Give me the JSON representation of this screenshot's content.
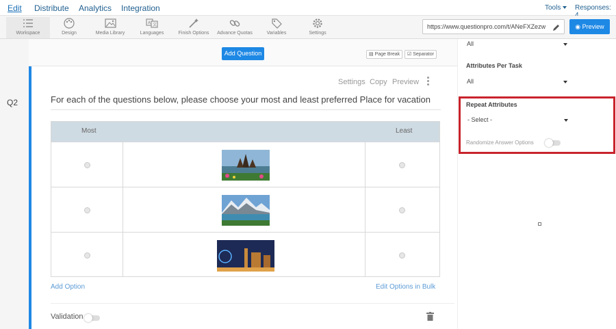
{
  "topnav": {
    "items": [
      "Edit",
      "Distribute",
      "Analytics",
      "Integration"
    ],
    "tools_label": "Tools",
    "responses_label": "Responses: 4"
  },
  "toolbar": {
    "items": [
      {
        "label": "Workspace",
        "icon": "list-icon"
      },
      {
        "label": "Design",
        "icon": "palette-icon"
      },
      {
        "label": "Media Library",
        "icon": "image-icon"
      },
      {
        "label": "Languages",
        "icon": "translate-icon"
      },
      {
        "label": "Finish Options",
        "icon": "magic-wand-icon"
      },
      {
        "label": "Advance Quotas",
        "icon": "link-icon"
      },
      {
        "label": "Variables",
        "icon": "tag-icon"
      },
      {
        "label": "Settings",
        "icon": "gear-icon"
      }
    ],
    "url": "https://www.questionpro.com/t/ANeFXZezw",
    "preview_label": "Preview"
  },
  "canvas": {
    "add_question_label": "Add Question",
    "page_break_label": "Page Break",
    "separator_label": "Separator"
  },
  "question": {
    "number": "Q2",
    "tools": [
      "Settings",
      "Copy",
      "Preview"
    ],
    "text": "For each of the questions below, please choose your most and least preferred Place for vacation",
    "col_most": "Most",
    "col_least": "Least",
    "rows": [
      {
        "image": "temple-lake-photo"
      },
      {
        "image": "mountain-lake-photo"
      },
      {
        "image": "city-night-photo"
      }
    ],
    "add_option_label": "Add Option",
    "edit_bulk_label": "Edit Options in Bulk",
    "validation_label": "Validation"
  },
  "right_panel": {
    "top_select_value": "All",
    "attributes_per_task_label": "Attributes Per Task",
    "attributes_per_task_value": "All",
    "repeat_attributes_label": "Repeat Attributes",
    "repeat_attributes_value": "- Select -",
    "randomize_label": "Randomize Answer Options"
  },
  "colors": {
    "accent": "#1e88e5",
    "highlight_border": "#c8232c",
    "grid_header": "#cfdbe3"
  }
}
